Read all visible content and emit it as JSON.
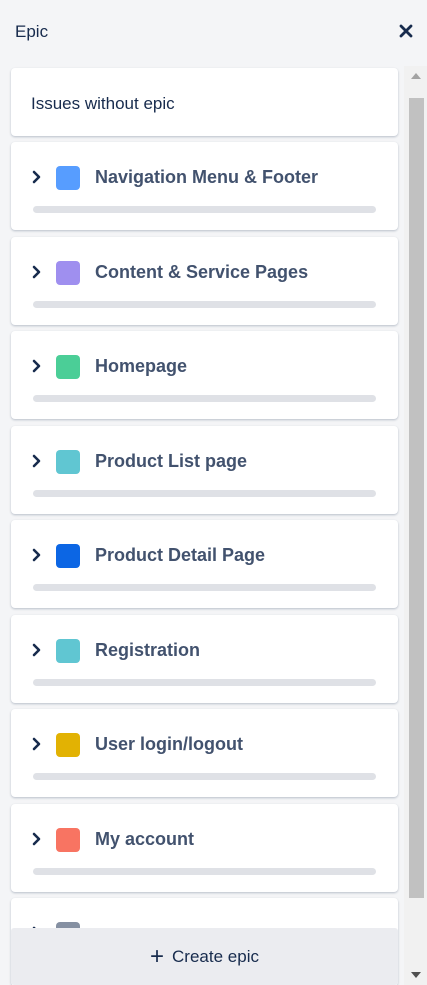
{
  "header": {
    "title": "Epic",
    "close_glyph": "✕",
    "close_icon": "close-icon"
  },
  "no_epic": {
    "label": "Issues without epic"
  },
  "epics": [
    {
      "name": "Navigation Menu & Footer",
      "color": "#579dff",
      "progress": 0
    },
    {
      "name": "Content & Service Pages",
      "color": "#9f8fef",
      "progress": 0
    },
    {
      "name": "Homepage",
      "color": "#4bce97",
      "progress": 0
    },
    {
      "name": "Product List page",
      "color": "#60c6d2",
      "progress": 0
    },
    {
      "name": "Product Detail Page",
      "color": "#0c66e4",
      "progress": 0
    },
    {
      "name": "Registration",
      "color": "#60c6d2",
      "progress": 0
    },
    {
      "name": "User login/logout",
      "color": "#e2b203",
      "progress": 0
    },
    {
      "name": "My account",
      "color": "#f87462",
      "progress": 0
    },
    {
      "name": "",
      "color": "#8590a2",
      "progress": 0
    }
  ],
  "footer": {
    "plus": "+",
    "label": "Create epic"
  },
  "icons": {
    "expand": "chevron-right-icon",
    "scroll_up": "scroll-up-arrow-icon",
    "scroll_down": "scroll-down-arrow-icon"
  }
}
